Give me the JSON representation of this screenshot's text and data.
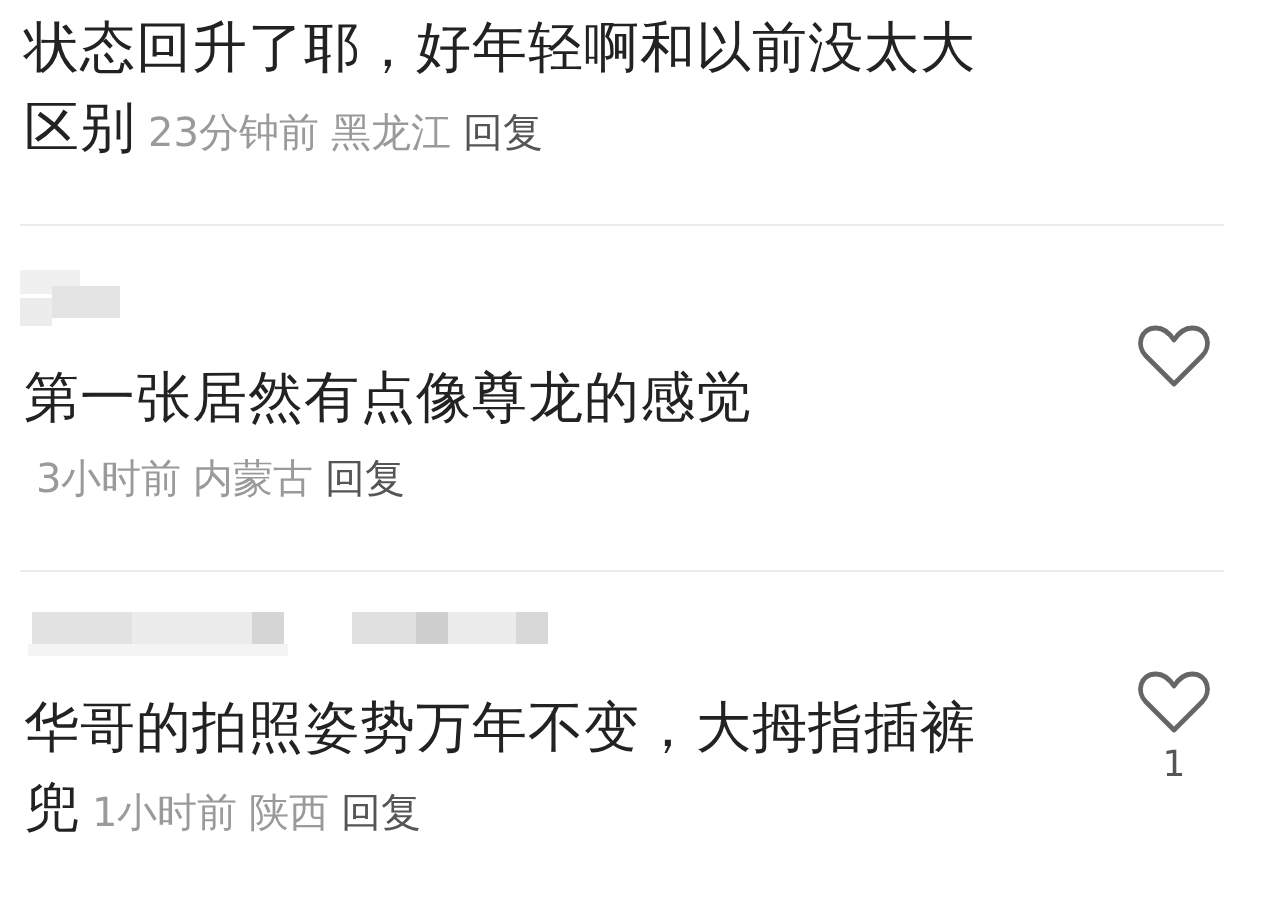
{
  "comments": [
    {
      "text_lines": [
        "状态回升了耶，好年轻啊和以前没太大",
        "区别"
      ],
      "time": "23分钟前",
      "location": "黑龙江",
      "reply": "回复"
    },
    {
      "author": {
        "kind": "blurred-short"
      },
      "text_lines": [
        "第一张居然有点像尊龙的感觉"
      ],
      "time": "3小时前",
      "location": "内蒙古",
      "reply": "回复",
      "liked": false
    },
    {
      "author": {
        "kind": "blurred-long"
      },
      "text_lines": [
        "华哥的拍照姿势万年不变，大拇指插裤",
        "兜"
      ],
      "time": "1小时前",
      "location": "陕西",
      "reply": "回复",
      "liked": false,
      "like_count": "1"
    }
  ]
}
